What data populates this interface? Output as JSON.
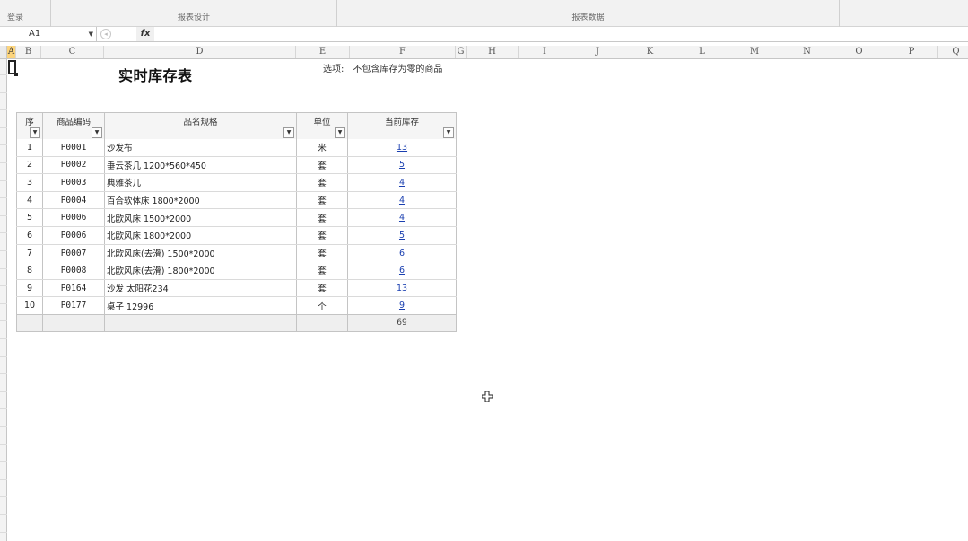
{
  "ribbon": {
    "login": "登录",
    "report_design": "报表设计",
    "report_data": "报表数据"
  },
  "formula_bar": {
    "cell_ref": "A1",
    "fx": "fx"
  },
  "columns": [
    "A",
    "B",
    "C",
    "D",
    "E",
    "F",
    "G",
    "H",
    "I",
    "J",
    "K",
    "L",
    "M",
    "N",
    "O",
    "P",
    "Q"
  ],
  "selected_column": "A",
  "report": {
    "title": "实时库存表",
    "option_label": "选项:",
    "option_value": "不包含库存为零的商品"
  },
  "table": {
    "headers": {
      "idx": "序",
      "code": "商品编码",
      "name": "品名规格",
      "unit": "单位",
      "qty": "当前库存"
    },
    "rows": [
      {
        "idx": "1",
        "code": "P0001",
        "name": "沙发布",
        "unit": "米",
        "qty": "13"
      },
      {
        "idx": "2",
        "code": "P0002",
        "name": "垂云茶几 1200*560*450",
        "unit": "套",
        "qty": "5"
      },
      {
        "idx": "3",
        "code": "P0003",
        "name": "典雅茶几",
        "unit": "套",
        "qty": "4"
      },
      {
        "idx": "4",
        "code": "P0004",
        "name": "百合软体床 1800*2000",
        "unit": "套",
        "qty": "4"
      },
      {
        "idx": "5",
        "code": "P0006",
        "name": "北欧风床 1500*2000",
        "unit": "套",
        "qty": "4"
      },
      {
        "idx": "6",
        "code": "P0006",
        "name": "北欧风床 1800*2000",
        "unit": "套",
        "qty": "5"
      },
      {
        "idx": "7",
        "code": "P0007",
        "name": "北欧风床(去滑) 1500*2000",
        "unit": "套",
        "qty": "6"
      },
      {
        "idx": "8",
        "code": "P0008",
        "name": "北欧风床(去滑) 1800*2000",
        "unit": "套",
        "qty": "6"
      },
      {
        "idx": "9",
        "code": "P0164",
        "name": "沙发 太阳花234",
        "unit": "套",
        "qty": "13"
      },
      {
        "idx": "10",
        "code": "P0177",
        "name": "桌子 12996",
        "unit": "个",
        "qty": "9"
      }
    ],
    "total": "69"
  }
}
